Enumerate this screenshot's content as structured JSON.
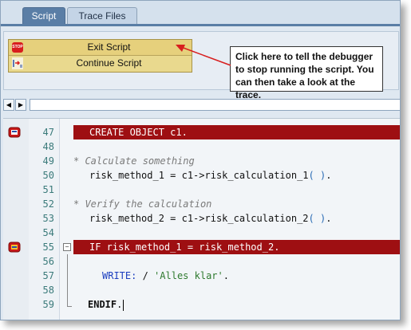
{
  "tabs": [
    {
      "label": "Script"
    },
    {
      "label": "Trace Files"
    }
  ],
  "menu": {
    "exit_label": "Exit Script",
    "exit_icon_text": "STOP",
    "continue_label": "Continue Script"
  },
  "callout": {
    "text": "Click here to tell the debugger to stop running the script. You can then take a look at the trace."
  },
  "editor": {
    "lines": [
      {
        "num": "47",
        "text": "CREATE OBJECT c1."
      },
      {
        "num": "48",
        "text": ""
      },
      {
        "num": "49",
        "text": "* Calculate something"
      },
      {
        "num": "50",
        "text_a": "risk_method_1 = c1->risk_calculation_1",
        "text_b": "( )",
        "text_c": "."
      },
      {
        "num": "51",
        "text": ""
      },
      {
        "num": "52",
        "text": "* Verify the calculation"
      },
      {
        "num": "53",
        "text_a": "risk_method_2 = c1->risk_calculation_2",
        "text_b": "( )",
        "text_c": "."
      },
      {
        "num": "54",
        "text": ""
      },
      {
        "num": "55",
        "text": "IF risk_method_1 = risk_method_2."
      },
      {
        "num": "56",
        "text": ""
      },
      {
        "num": "57",
        "text_a": "WRITE:",
        "text_b": " / ",
        "text_c": "'Alles klar'",
        "text_d": "."
      },
      {
        "num": "58",
        "text": ""
      },
      {
        "num": "59",
        "text_a": "ENDIF",
        "text_b": "."
      }
    ]
  },
  "colors": {
    "highlight": "#9e0f12",
    "tab_active": "#5a7ea6",
    "menu_bg": "#e9d98e",
    "arrow": "#d81e1e"
  },
  "icons": [
    "stop-icon",
    "continue-icon",
    "breakpoint-icon",
    "nav-left-icon",
    "nav-right-icon"
  ]
}
